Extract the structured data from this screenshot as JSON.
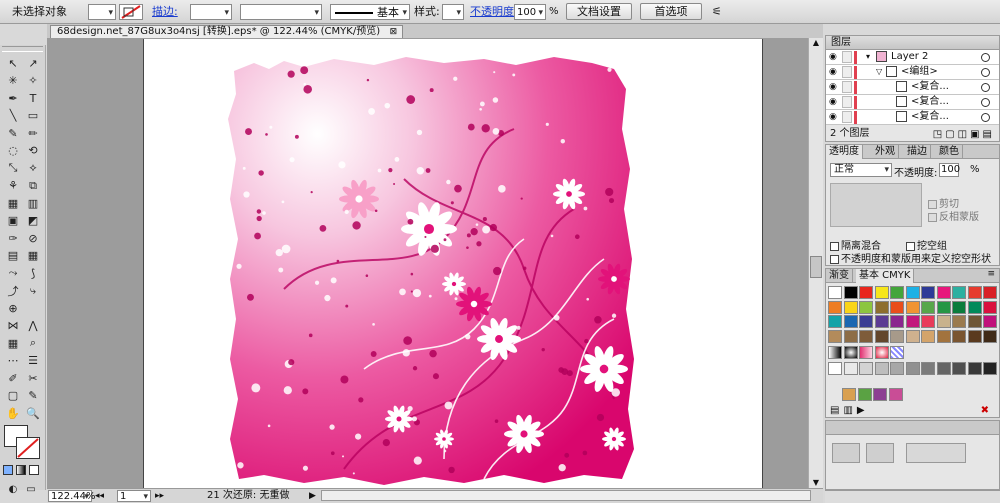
{
  "control": {
    "selection": "未选择对象",
    "stroke_label": "描边:",
    "brush": "基本",
    "style_label": "样式:",
    "opacity_label": "不透明度:",
    "opacity_value": "100",
    "percent": "%",
    "doc_setup": "文档设置",
    "preferences": "首选项"
  },
  "document": {
    "tab_title": "68design.net_87G8ux3o4nsj [转换].eps* @ 122.44% (CMYK/预览)",
    "close": "⊠"
  },
  "status": {
    "zoom": "122.44%",
    "page": "1",
    "info": "21 次还原: 无重做"
  },
  "layers": {
    "title": "图层",
    "items": [
      {
        "name": "Layer 2",
        "indent": 0
      },
      {
        "name": "<编组>",
        "indent": 1
      },
      {
        "name": "<复合...",
        "indent": 2
      },
      {
        "name": "<复合...",
        "indent": 2
      },
      {
        "name": "<复合...",
        "indent": 2
      }
    ],
    "count": "2 个图层"
  },
  "transparency": {
    "tabs": [
      "透明度",
      "外观",
      "描边",
      "颜色"
    ],
    "mode": "正常",
    "opacity_label": "不透明度:",
    "opacity_value": "100",
    "percent": "%",
    "clip": "剪切",
    "invert_mask": "反相蒙版",
    "isolate": "隔离混合",
    "knockout": "挖空组",
    "knockout_shape": "不透明度和蒙版用来定义挖空形状"
  },
  "swatches": {
    "tabs": [
      "渐变",
      "基本 CMYK"
    ],
    "row1": [
      "#ffffff",
      "#000000",
      "#e8261c",
      "#f7e61b",
      "#43a53a",
      "#1db1e5",
      "#2d3a97",
      "#e7177c",
      "#2bb0a0",
      "#e63b2e",
      "#d81f26"
    ],
    "row2": [
      "#ee7d23",
      "#f9d418",
      "#8cc63f",
      "#8d6e2e",
      "#e94e1b",
      "#f09433",
      "#57a74a",
      "#259645",
      "#0b7c3c",
      "#008a5a",
      "#d9113d"
    ],
    "row3": [
      "#13a3a8",
      "#1b67b1",
      "#3b3d93",
      "#5c3b93",
      "#8b268e",
      "#c2187c",
      "#e83b5a",
      "#c8b28d",
      "#9a7a4e",
      "#6e5635",
      "#c0117a"
    ],
    "row4": [
      "#b38b5b",
      "#8d6d47",
      "#7e5c3a",
      "#63462c",
      "#a79a8a",
      "#cfb18e",
      "#d4a46a",
      "#a2733e",
      "#7a5530",
      "#5a3a1f",
      "#3f2a17"
    ],
    "row6": [
      "#d9a050",
      "#5aa243",
      "#8c3f92",
      "#c94d96"
    ]
  },
  "artwork": {
    "flower_color": "#ffffff",
    "main_color": "#e2127a"
  }
}
